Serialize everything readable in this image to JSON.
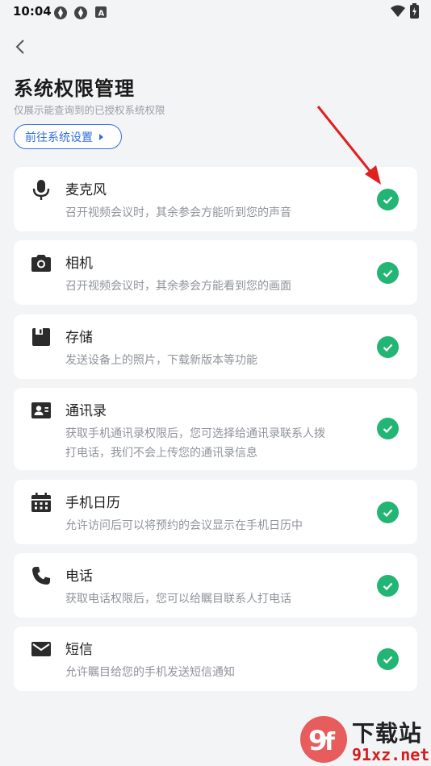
{
  "status_bar": {
    "time": "10:04"
  },
  "header": {
    "title": "系统权限管理",
    "subtitle": "仅展示能查询到的已授权系统权限",
    "goto_settings_label": "前往系统设置"
  },
  "permissions": [
    {
      "icon": "microphone-icon",
      "title": "麦克风",
      "desc": [
        "召开视频会议时，其余参会方能听到您的声音"
      ],
      "granted": true
    },
    {
      "icon": "camera-icon",
      "title": "相机",
      "desc": [
        "召开视频会议时，其余参会方能看到您的画面"
      ],
      "granted": true
    },
    {
      "icon": "storage-icon",
      "title": "存储",
      "desc": [
        "发送设备上的照片，下载新版本等功能"
      ],
      "granted": true
    },
    {
      "icon": "contacts-icon",
      "title": "通讯录",
      "desc": [
        "获取手机通讯录权限后，您可选择给通讯录联系人拨",
        "打电话，我们不会上传您的通讯录信息"
      ],
      "granted": true
    },
    {
      "icon": "calendar-icon",
      "title": "手机日历",
      "desc": [
        "允许访问后可以将预约的会议显示在手机日历中"
      ],
      "granted": true
    },
    {
      "icon": "phone-icon",
      "title": "电话",
      "desc": [
        "获取电话权限后，您可以给瞩目联系人打电话"
      ],
      "granted": true
    },
    {
      "icon": "message-icon",
      "title": "短信",
      "desc": [
        "允许瞩目给您的手机发送短信通知"
      ],
      "granted": true
    }
  ],
  "colors": {
    "accent": "#2f6fe0",
    "check": "#22b573",
    "annotation_arrow": "#e02020"
  },
  "watermark": {
    "line1": "下载站",
    "line2": "91xz.net"
  }
}
